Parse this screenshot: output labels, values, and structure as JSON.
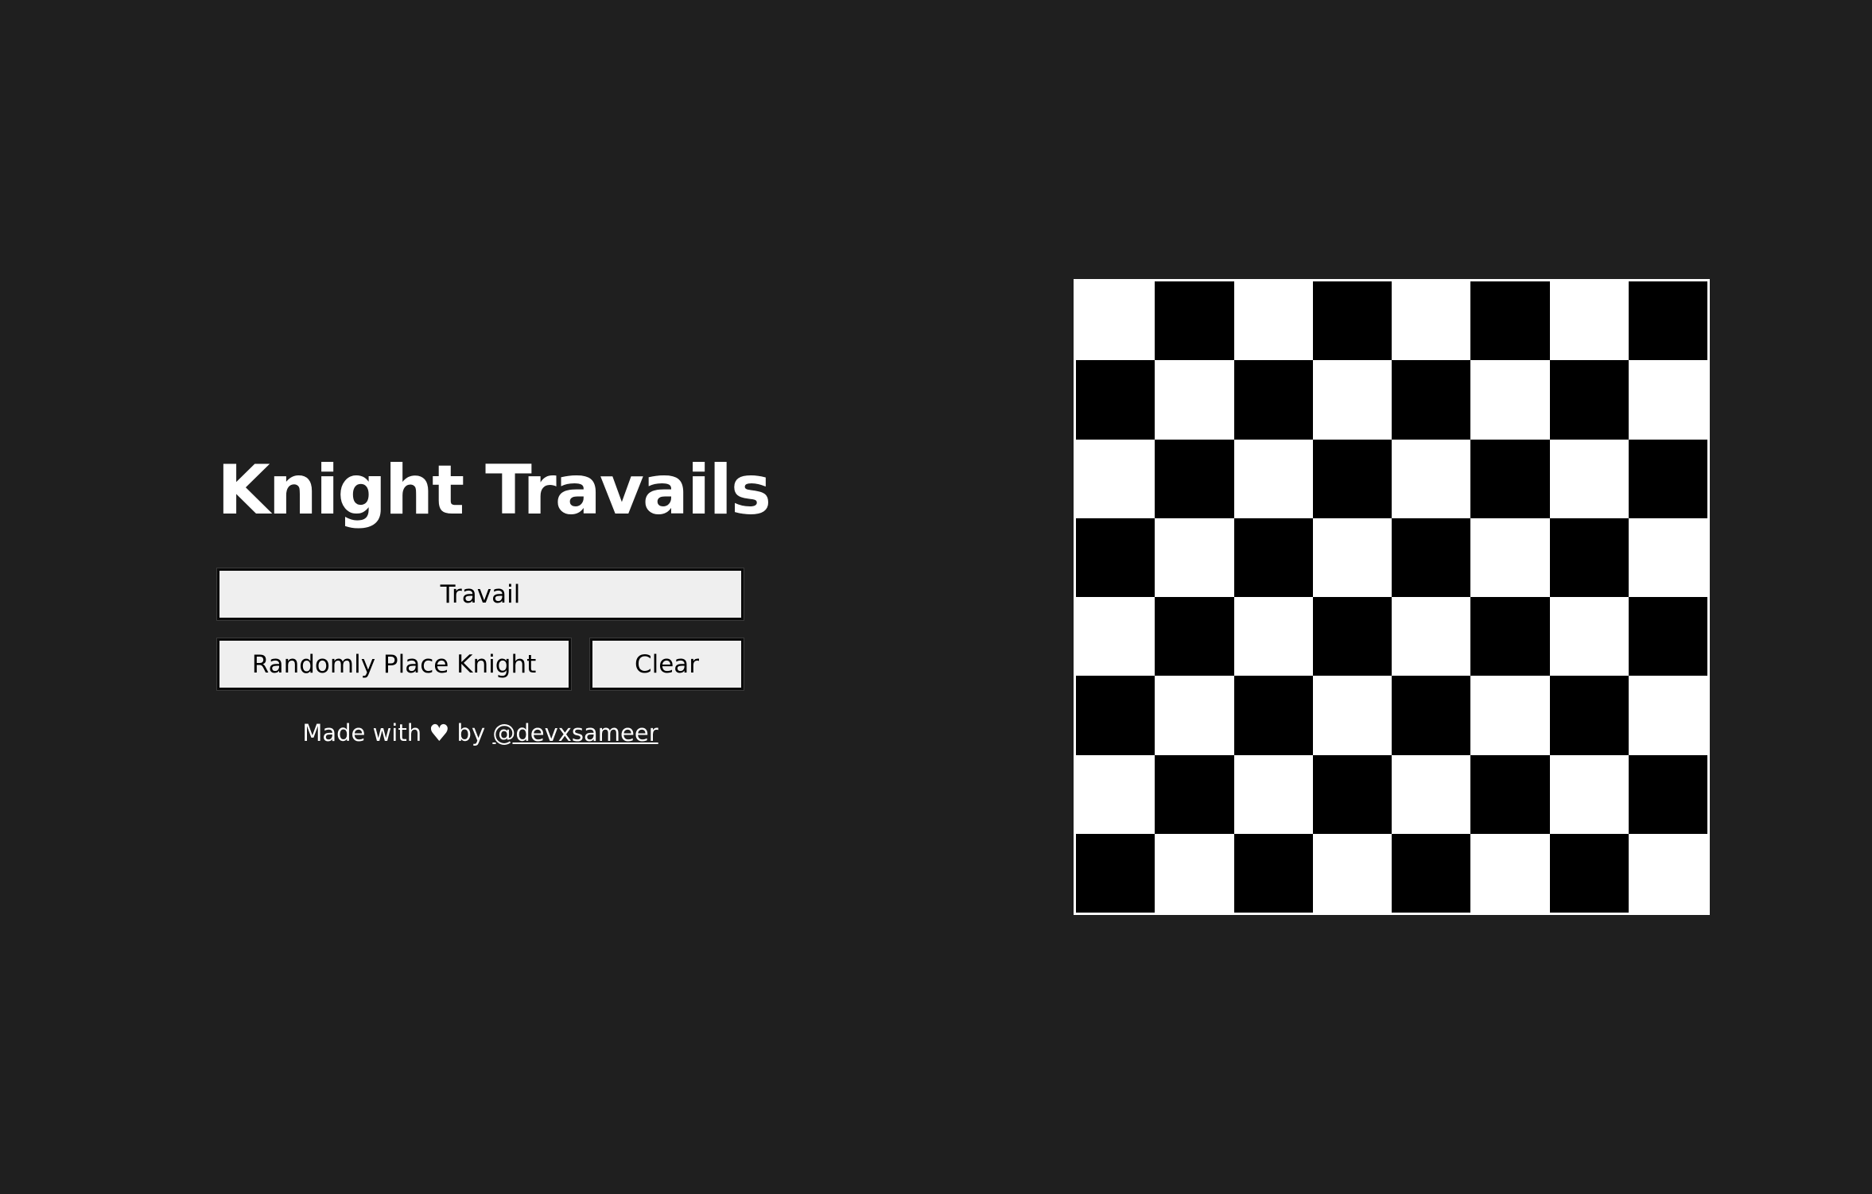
{
  "app": {
    "title": "Knight Travails"
  },
  "buttons": {
    "travail": "Travail",
    "random_place": "Randomly Place Knight",
    "clear": "Clear"
  },
  "footer": {
    "prefix": "Made with ♥ by ",
    "author_link": "@devxsameer"
  },
  "board": {
    "rows": 8,
    "cols": 8,
    "top_left_color": "light",
    "colors": {
      "light": "#ffffff",
      "dark": "#000000",
      "border": "#ffffff",
      "background": "#1f1f1f",
      "button_bg": "#efefef"
    }
  }
}
